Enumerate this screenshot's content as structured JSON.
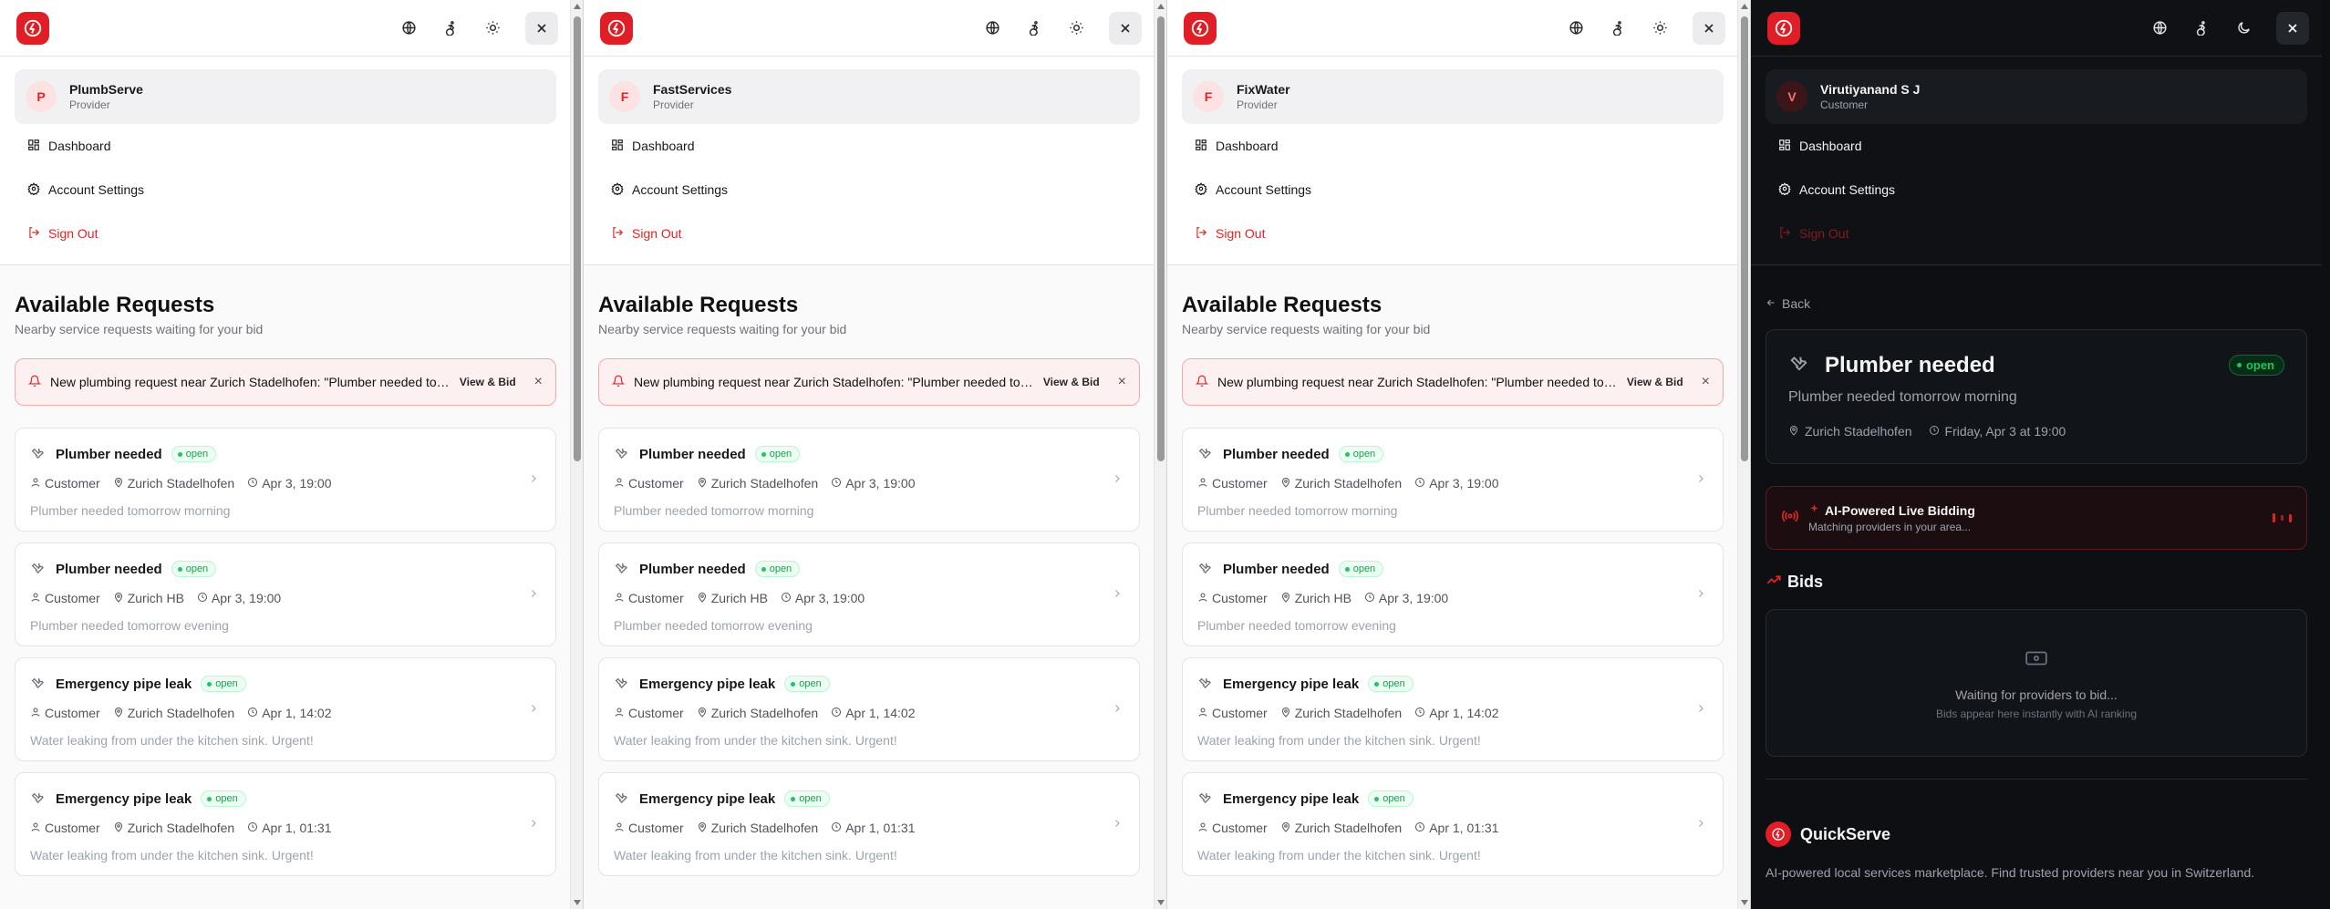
{
  "brand_color": "#e11d26",
  "icons": [
    "bolt-logo-icon",
    "globe-icon",
    "accessibility-icon",
    "sun-icon",
    "moon-icon",
    "close-icon",
    "dashboard-icon",
    "gear-icon",
    "sign-out-icon",
    "bell-icon",
    "wrench-icon",
    "user-icon",
    "map-pin-icon",
    "clock-icon",
    "chevron-right-icon",
    "arrow-left-icon",
    "radio-icon",
    "sparkles-icon",
    "trending-up-icon",
    "money-icon"
  ],
  "menu": {
    "dashboard": "Dashboard",
    "settings": "Account Settings",
    "signout": "Sign Out"
  },
  "providers_page": {
    "title": "Available Requests",
    "subtitle": "Nearby service requests waiting for your bid",
    "alert_message": "New plumbing request near Zurich Stadelhofen: \"Plumber needed tomorrow morning\"",
    "alert_action": "View & Bid",
    "close_glyph": "×",
    "requests": [
      {
        "title": "Plumber needed",
        "status": "open",
        "customer": "Customer",
        "location": "Zurich Stadelhofen",
        "time": "Apr 3, 19:00",
        "desc": "Plumber needed tomorrow morning"
      },
      {
        "title": "Plumber needed",
        "status": "open",
        "customer": "Customer",
        "location": "Zurich HB",
        "time": "Apr 3, 19:00",
        "desc": "Plumber needed tomorrow evening"
      },
      {
        "title": "Emergency pipe leak",
        "status": "open",
        "customer": "Customer",
        "location": "Zurich Stadelhofen",
        "time": "Apr 1, 14:02",
        "desc": "Water leaking from under the kitchen sink. Urgent!"
      },
      {
        "title": "Emergency pipe leak",
        "status": "open",
        "customer": "Customer",
        "location": "Zurich Stadelhofen",
        "time": "Apr 1, 01:31",
        "desc": "Water leaking from under the kitchen sink. Urgent!"
      }
    ]
  },
  "panels": [
    {
      "user": {
        "initial": "P",
        "name": "PlumbServe",
        "role": "Provider"
      }
    },
    {
      "user": {
        "initial": "F",
        "name": "FastServices",
        "role": "Provider"
      }
    },
    {
      "user": {
        "initial": "F",
        "name": "FixWater",
        "role": "Provider"
      }
    }
  ],
  "customer_panel": {
    "user": {
      "initial": "V",
      "name": "Virutiyanand S J",
      "role": "Customer"
    },
    "back_label": "Back",
    "request": {
      "title": "Plumber needed",
      "status": "open",
      "desc": "Plumber needed tomorrow morning",
      "location": "Zurich Stadelhofen",
      "time": "Friday, Apr 3 at 19:00"
    },
    "ai": {
      "title": "AI-Powered Live Bidding",
      "subtitle": "Matching providers in your area..."
    },
    "bids_heading": "Bids",
    "waiting": "Waiting for providers to bid...",
    "waiting_sub": "Bids appear here instantly with AI ranking",
    "footer": {
      "brand": "QuickServe",
      "text": "AI-powered local services marketplace. Find trusted providers near you in Switzerland."
    }
  }
}
